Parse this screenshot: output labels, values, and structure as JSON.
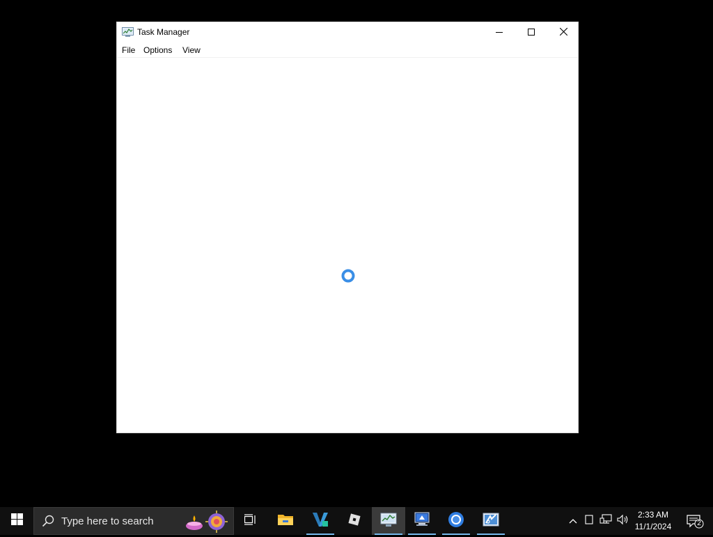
{
  "window": {
    "title": "Task Manager",
    "app_icon": "task-manager-icon",
    "controls": {
      "minimize_icon": "minimize-icon",
      "maximize_icon": "maximize-icon",
      "close_icon": "close-icon"
    },
    "menu": [
      "File",
      "Options",
      "View"
    ],
    "loading_indicator": "spinner-icon"
  },
  "taskbar": {
    "start_icon": "windows-logo-icon",
    "search": {
      "placeholder": "Type here to search",
      "highlight_icon": "search-highlight-icon"
    },
    "pinned": [
      {
        "name": "task-view",
        "icon": "task-view-icon",
        "active": false,
        "running": false
      },
      {
        "name": "file-explorer",
        "icon": "folder-icon",
        "active": false,
        "running": false
      },
      {
        "name": "visual-studio-code",
        "icon": "vscode-icon",
        "active": false,
        "running": true
      },
      {
        "name": "roblox",
        "icon": "roblox-icon",
        "active": false,
        "running": false
      },
      {
        "name": "task-manager",
        "icon": "task-manager-icon",
        "active": true,
        "running": true
      },
      {
        "name": "remote-desktop",
        "icon": "monitor-icon",
        "active": false,
        "running": true
      },
      {
        "name": "chrome",
        "icon": "chrome-icon",
        "active": false,
        "running": true
      },
      {
        "name": "snipping-tool",
        "icon": "snipping-tool-icon",
        "active": false,
        "running": true
      }
    ],
    "tray": {
      "show_hidden_icon": "chevron-up-icon",
      "tablet_icon": "tablet-icon",
      "network_icon": "network-icon",
      "volume_icon": "volume-icon"
    },
    "clock": {
      "time": "2:33 AM",
      "date": "11/1/2024"
    },
    "notifications": {
      "icon": "notification-icon",
      "count": "2"
    }
  },
  "colors": {
    "accent": "#76b9ed",
    "spinner": "#3a8ee6",
    "taskbar": "#101010",
    "desktop": "#000000"
  }
}
